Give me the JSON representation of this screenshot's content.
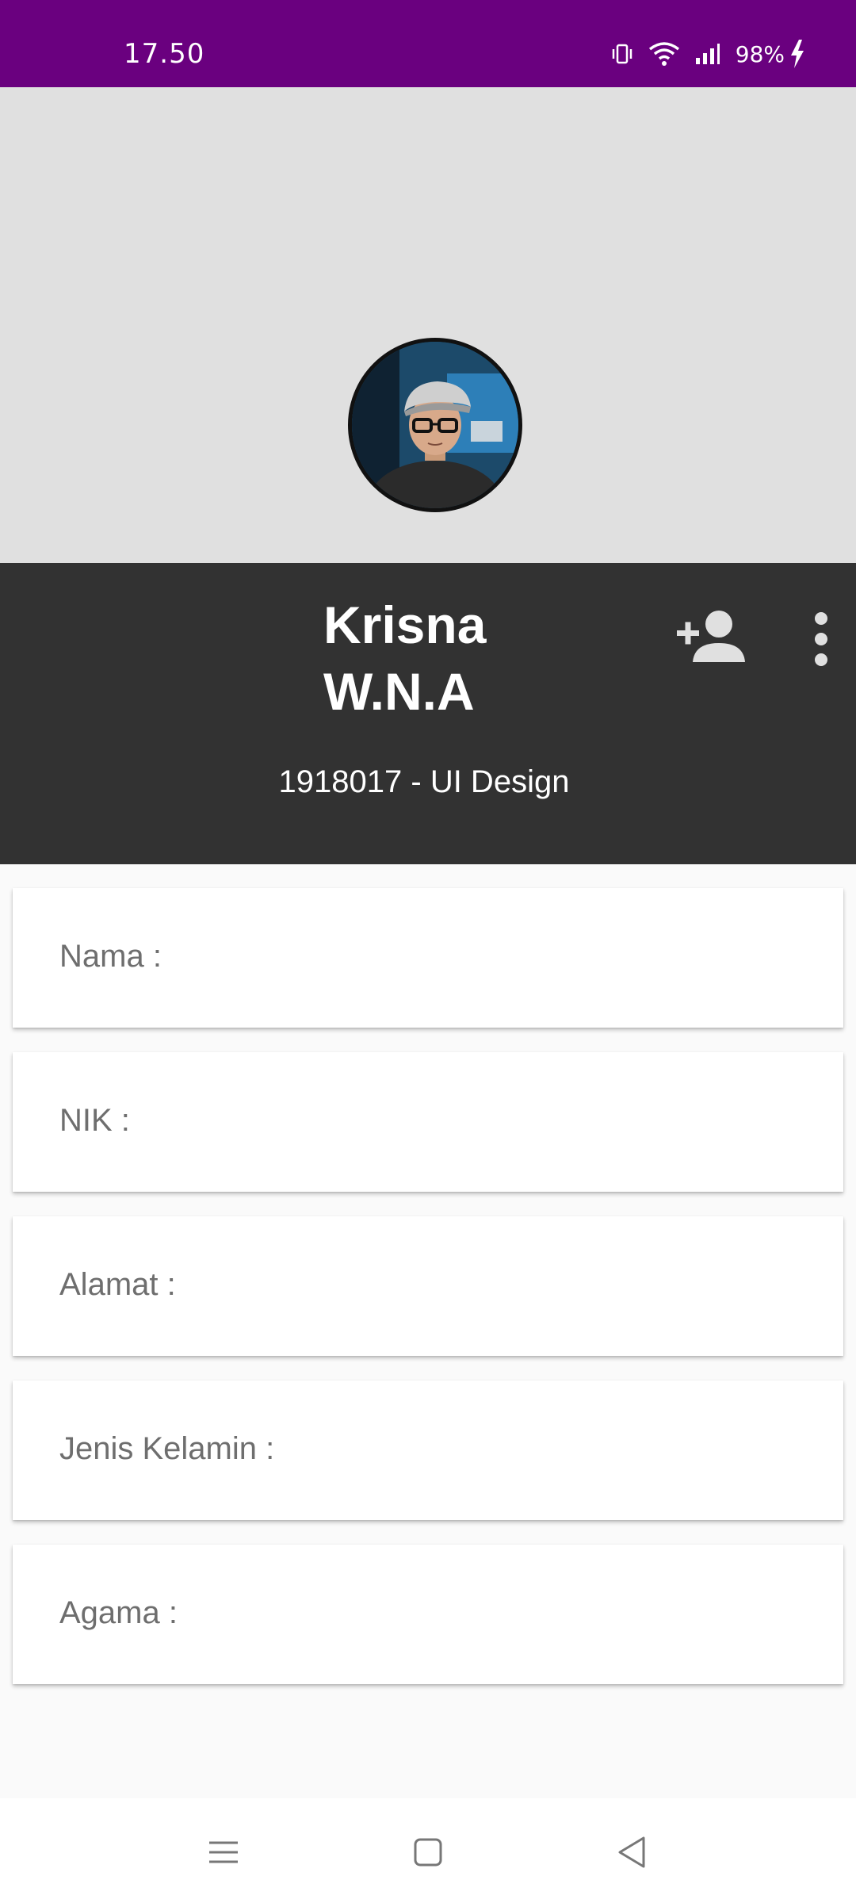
{
  "status_bar": {
    "time": "17.50",
    "battery": "98%",
    "icons": [
      "vibrate-icon",
      "wifi-icon",
      "signal-icon",
      "charging-icon"
    ],
    "background": "#6a007f"
  },
  "profile": {
    "name_line1": "Krisna",
    "name_line2": "W.N.A",
    "subtitle": "1918017 - UI Design",
    "actions": [
      "add-person-icon",
      "more-vert-icon"
    ]
  },
  "fields": [
    {
      "label": "Nama :"
    },
    {
      "label": "NIK :"
    },
    {
      "label": "Alamat :"
    },
    {
      "label": "Jenis Kelamin :"
    },
    {
      "label": "Agama :"
    }
  ],
  "nav_bar": {
    "buttons": [
      "menu-icon",
      "home-icon",
      "back-icon"
    ]
  },
  "colors": {
    "status_bar": "#6a007f",
    "header": "#323232",
    "cover": "#e0e0e0",
    "label": "#6e6e6e"
  }
}
